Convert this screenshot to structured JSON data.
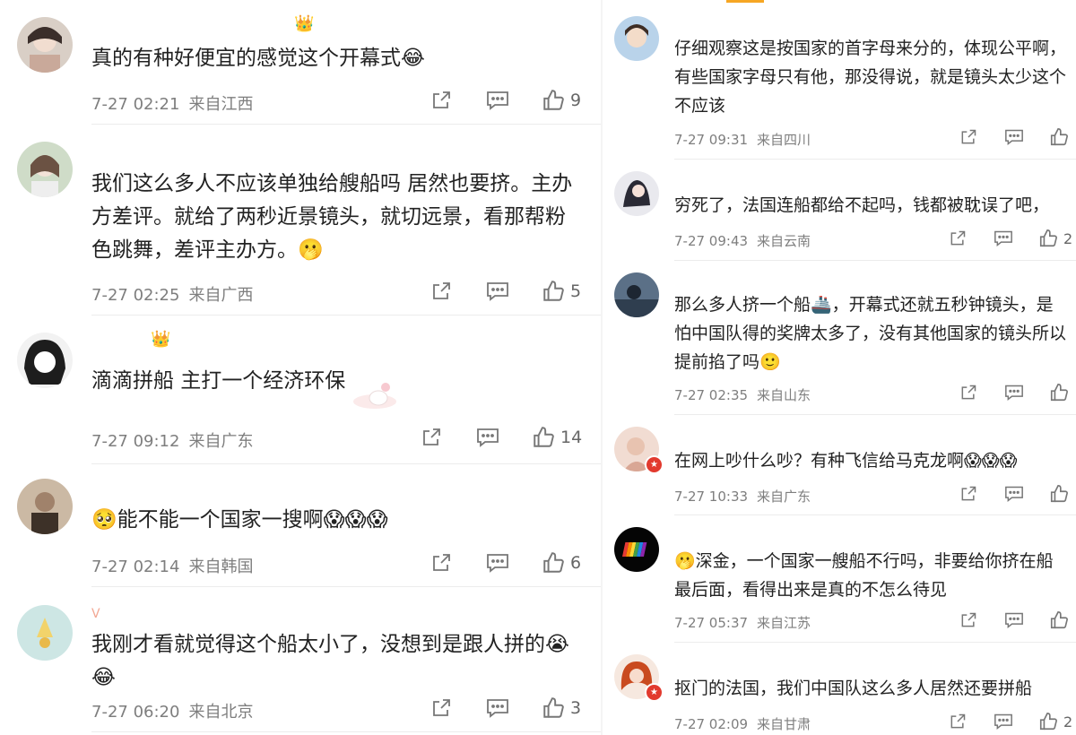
{
  "left": [
    {
      "name": "",
      "text": "真的有种好便宜的感觉这个开幕式😂",
      "date": "7-27 02:21",
      "location": "来自江西",
      "likes": "9",
      "crown": true
    },
    {
      "name": "",
      "text": "我们这么多人不应该单独给艘船吗 居然也要挤。主办方差评。就给了两秒近景镜头，就切远景，看那帮粉色跳舞，差评主办方。🫢",
      "date": "7-27 02:25",
      "location": "来自广西",
      "likes": "5",
      "crown": false
    },
    {
      "name": "",
      "text": "滴滴拼船 主打一个经济环保",
      "date": "7-27 09:12",
      "location": "来自广东",
      "likes": "14",
      "crown": true
    },
    {
      "name": "",
      "text": "🥺能不能一个国家一搜啊😱😱😱",
      "date": "7-27 02:14",
      "location": "来自韩国",
      "likes": "6",
      "crown": false
    },
    {
      "name": "V",
      "text": "我刚才看就觉得这个船太小了，没想到是跟人拼的😭😂",
      "date": "7-27 06:20",
      "location": "来自北京",
      "likes": "3",
      "crown": false
    }
  ],
  "right": [
    {
      "name": "",
      "text": "仔细观察这是按国家的首字母来分的，体现公平啊，有些国家字母只有他，那没得说，就是镜头太少这个不应该",
      "date": "7-27 09:31",
      "location": "来自四川",
      "likes": ""
    },
    {
      "name": "",
      "text": "穷死了，法国连船都给不起吗，钱都被耽误了吧，",
      "date": "7-27 09:43",
      "location": "来自云南",
      "likes": "2"
    },
    {
      "name": "",
      "text": "那么多人挤一个船🚢，开幕式还就五秒钟镜头，是怕中国队得的奖牌太多了，没有其他国家的镜头所以提前掐了吗🙂",
      "date": "7-27 02:35",
      "location": "来自山东",
      "likes": ""
    },
    {
      "name": "",
      "text": "在网上吵什么吵？有种飞信给马克龙啊😱😱😱",
      "date": "7-27 10:33",
      "location": "来自广东",
      "likes": ""
    },
    {
      "name": "",
      "text": "🫢深金，一个国家一艘船不行吗，非要给你挤在船最后面，看得出来是真的不怎么待见",
      "date": "7-27 05:37",
      "location": "来自江苏",
      "likes": ""
    },
    {
      "name": "",
      "text": "抠门的法国，我们中国队这么多人居然还要拼船",
      "date": "7-27 02:09",
      "location": "来自甘肃",
      "likes": "2"
    }
  ],
  "icons": {
    "share": "share-icon",
    "comment": "comment-icon",
    "like": "thumbs-up-icon",
    "crown": "crown-icon",
    "verified": "verified-badge-icon"
  },
  "colors": {
    "accent": "#f6a623",
    "name": "#e8603c",
    "meta": "#7e7e7e",
    "badge": "#e23a2e"
  }
}
